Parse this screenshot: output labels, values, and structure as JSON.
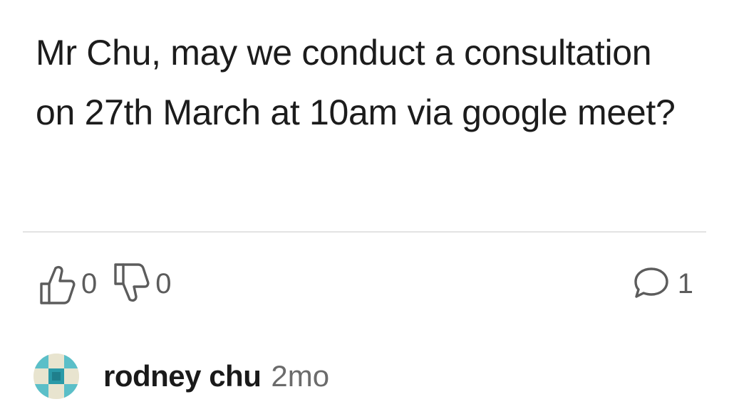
{
  "post": {
    "text": "Mr Chu, may we conduct a consultation on 27th March at 10am via google meet?"
  },
  "actions": {
    "upvote_count": "0",
    "downvote_count": "0",
    "comment_count": "1"
  },
  "author": {
    "name": "rodney chu",
    "time": "2mo"
  },
  "icons": {
    "upvote": "thumbs-up-icon",
    "downvote": "thumbs-down-icon",
    "comment": "speech-bubble-icon",
    "avatar": "user-avatar"
  },
  "colors": {
    "text": "#1c1c1c",
    "muted": "#6b6b6b",
    "divider": "#e3e3e3",
    "avatar_teal": "#5bbfc8"
  }
}
